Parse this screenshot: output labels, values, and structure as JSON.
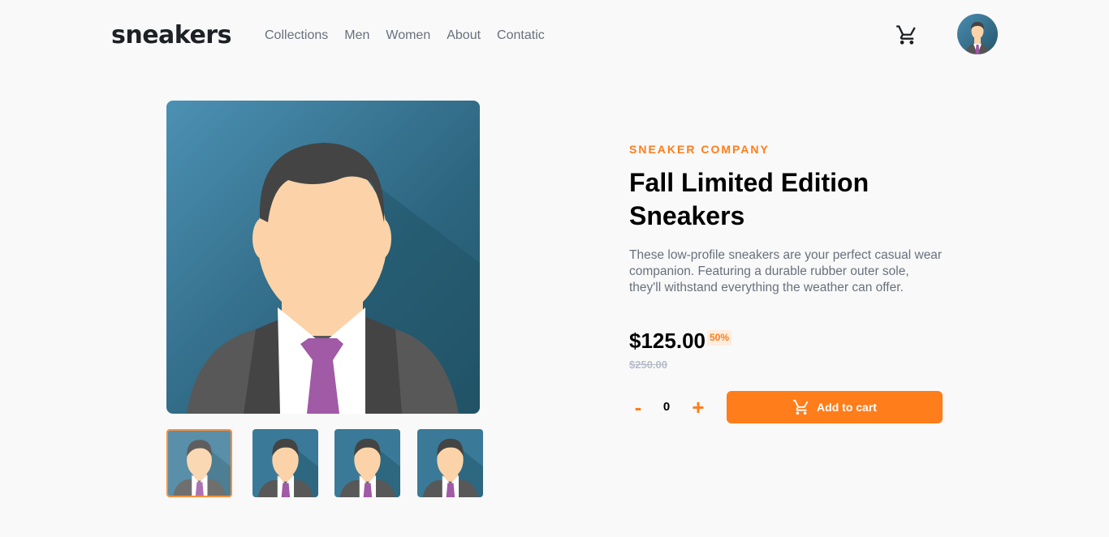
{
  "header": {
    "logo": "sneakers",
    "nav": [
      "Collections",
      "Men",
      "Women",
      "About",
      "Contatic"
    ],
    "cart_icon": "cart-icon",
    "avatar_icon": "user-avatar"
  },
  "gallery": {
    "main_image": "businessman-avatar-illustration",
    "thumbnails_count": 4,
    "active_thumbnail": 1
  },
  "product": {
    "company": "SNEAKER COMPANY",
    "title": "Fall Limited Edition Sneakers",
    "description": "These low-profile sneakers are your perfect casual wear companion. Featuring a durable rubber outer sole, they'll withstand everything the weather can offer.",
    "price": "$125.00",
    "discount": "50%",
    "original_price": "$250.00"
  },
  "cart_controls": {
    "minus_label": "-",
    "quantity": "0",
    "plus_label": "+",
    "add_label": "Add to cart"
  },
  "colors": {
    "accent": "#ff7d1a",
    "accent_light": "#ffede0",
    "text_dark": "#1d2025",
    "text_muted": "#69707d"
  }
}
